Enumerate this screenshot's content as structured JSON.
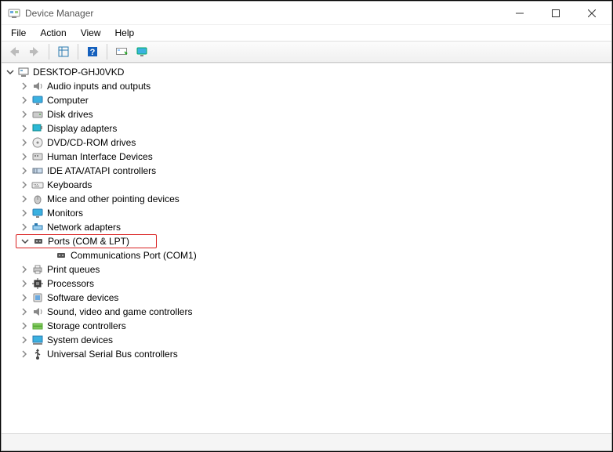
{
  "window": {
    "title": "Device Manager"
  },
  "menu": {
    "file": "File",
    "action": "Action",
    "view": "View",
    "help": "Help"
  },
  "tree": {
    "root": "DESKTOP-GHJ0VKD",
    "nodes": {
      "audio": "Audio inputs and outputs",
      "computer": "Computer",
      "disk": "Disk drives",
      "display": "Display adapters",
      "dvd": "DVD/CD-ROM drives",
      "hid": "Human Interface Devices",
      "ide": "IDE ATA/ATAPI controllers",
      "keyboards": "Keyboards",
      "mice": "Mice and other pointing devices",
      "monitors": "Monitors",
      "network": "Network adapters",
      "ports": "Ports (COM & LPT)",
      "comport": "Communications Port (COM1)",
      "printq": "Print queues",
      "processors": "Processors",
      "software": "Software devices",
      "sound": "Sound, video and game controllers",
      "storage": "Storage controllers",
      "system": "System devices",
      "usb": "Universal Serial Bus controllers"
    }
  }
}
